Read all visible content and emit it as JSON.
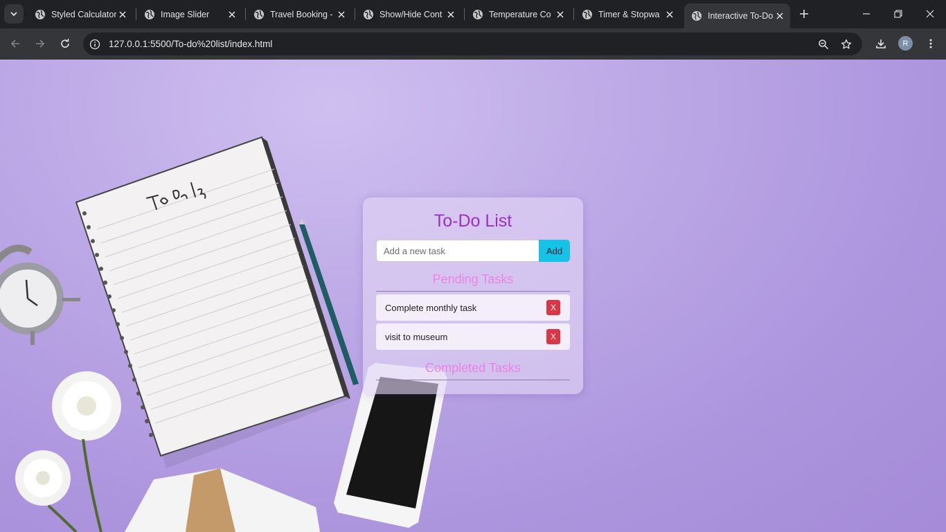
{
  "browser": {
    "tabs": [
      {
        "title": "Styled Calculator"
      },
      {
        "title": "Image Slider"
      },
      {
        "title": "Travel Booking -"
      },
      {
        "title": "Show/Hide Cont"
      },
      {
        "title": "Temperature Co"
      },
      {
        "title": "Timer & Stopwa"
      },
      {
        "title": "Interactive To-Do",
        "active": true
      }
    ],
    "url": "127.0.0.1:5500/To-do%20list/index.html",
    "profile_initial": "R"
  },
  "app": {
    "title": "To-Do List",
    "input": {
      "placeholder": "Add a new task",
      "value": ""
    },
    "add_label": "Add",
    "pending_title": "Pending Tasks",
    "pending": [
      {
        "text": "Complete monthly task",
        "delete_label": "X"
      },
      {
        "text": "visit to museum",
        "delete_label": "X"
      }
    ],
    "completed_title": "Completed Tasks",
    "completed": []
  },
  "colors": {
    "title": "#9b30c8",
    "section_title": "#ec82e6",
    "add_button": "#16c2e6",
    "delete_button": "#dc3545",
    "background": "#b9a3e3"
  },
  "icons": [
    "tab-search-icon",
    "globe-icon",
    "close-icon",
    "plus-icon",
    "minimize-icon",
    "restore-icon",
    "back-icon",
    "forward-icon",
    "reload-icon",
    "info-icon",
    "zoom-icon",
    "star-icon",
    "download-icon",
    "menu-icon"
  ]
}
